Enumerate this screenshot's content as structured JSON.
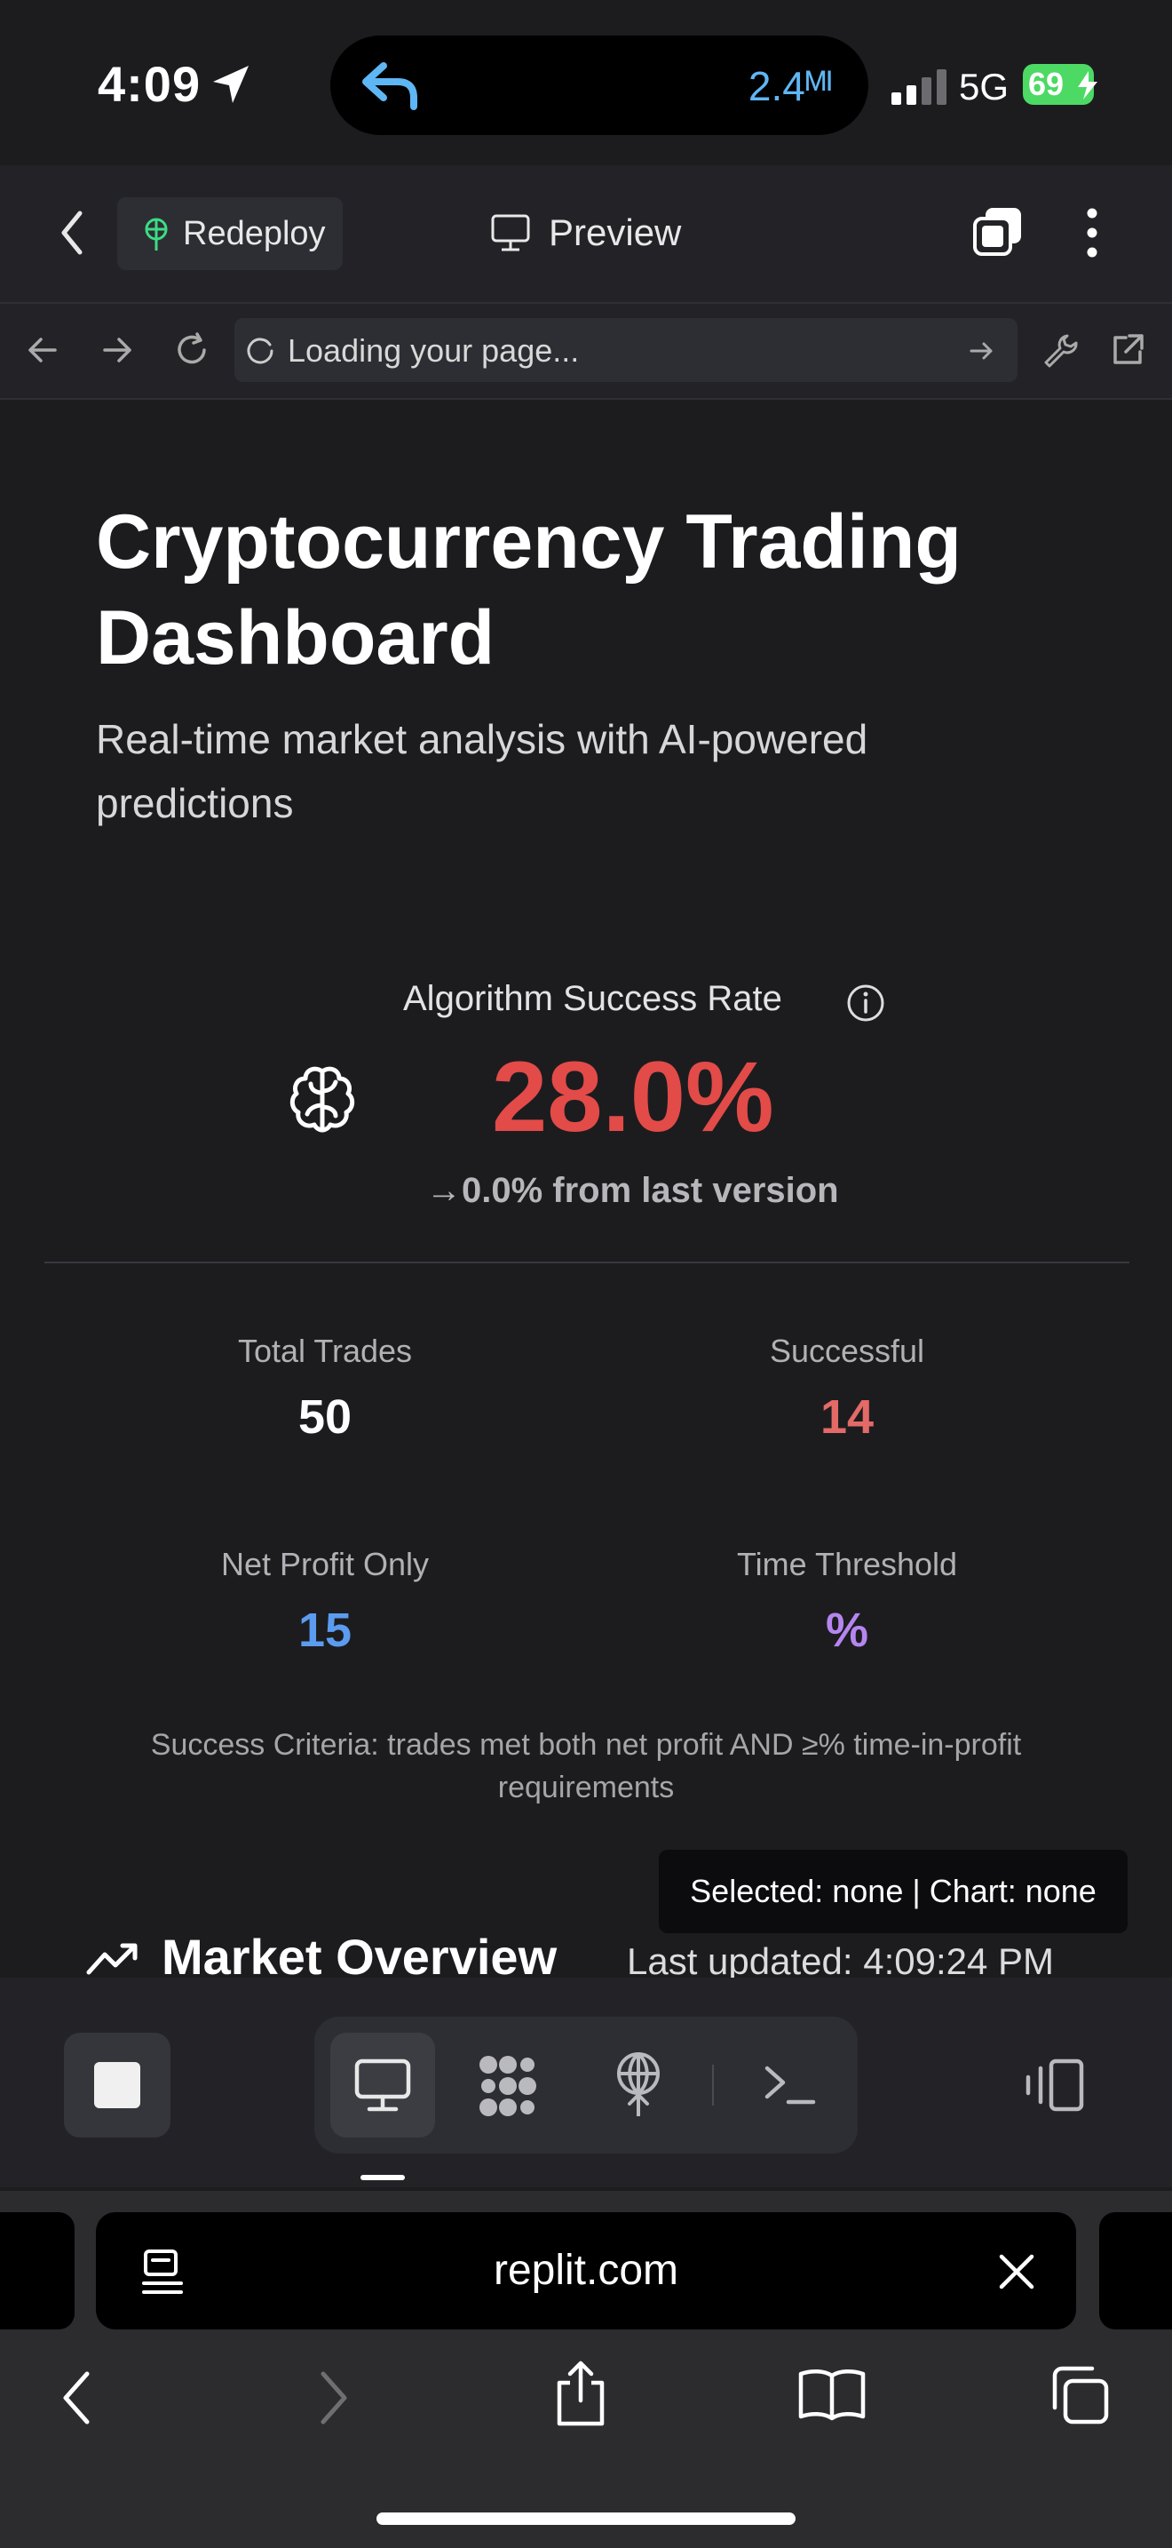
{
  "status_bar": {
    "time": "4:09",
    "island_distance": "2.4ᴹᴵ",
    "network": "5G",
    "battery": "69"
  },
  "app_header": {
    "redeploy_label": "Redeploy",
    "preview_label": "Preview"
  },
  "url_bar": {
    "loading_text": "Loading your page..."
  },
  "page": {
    "title": "Cryptocurrency Trading Dashboard",
    "subtitle": "Real-time market analysis with AI-powered predictions"
  },
  "algorithm": {
    "label": "Algorithm Success Rate",
    "rate": "28.0%",
    "change": "→0.0% from last version",
    "rate_color": "#e24b48"
  },
  "stats": [
    {
      "label": "Total Trades",
      "value": "50",
      "color": "#ffffff"
    },
    {
      "label": "Successful",
      "value": "14",
      "color": "#e36a67"
    },
    {
      "label": "Net Profit Only",
      "value": "15",
      "color": "#5b9cf0"
    },
    {
      "label": "Time Threshold",
      "value": "%",
      "color": "#b586f0"
    }
  ],
  "criteria": "Success Criteria: trades met both net profit AND ≥% time-in-profit requirements",
  "tooltip": "Selected: none | Chart: none",
  "market": {
    "title": "Market Overview",
    "last_updated": "Last updated: 4:09:24 PM"
  },
  "safari": {
    "address": "replit.com"
  }
}
